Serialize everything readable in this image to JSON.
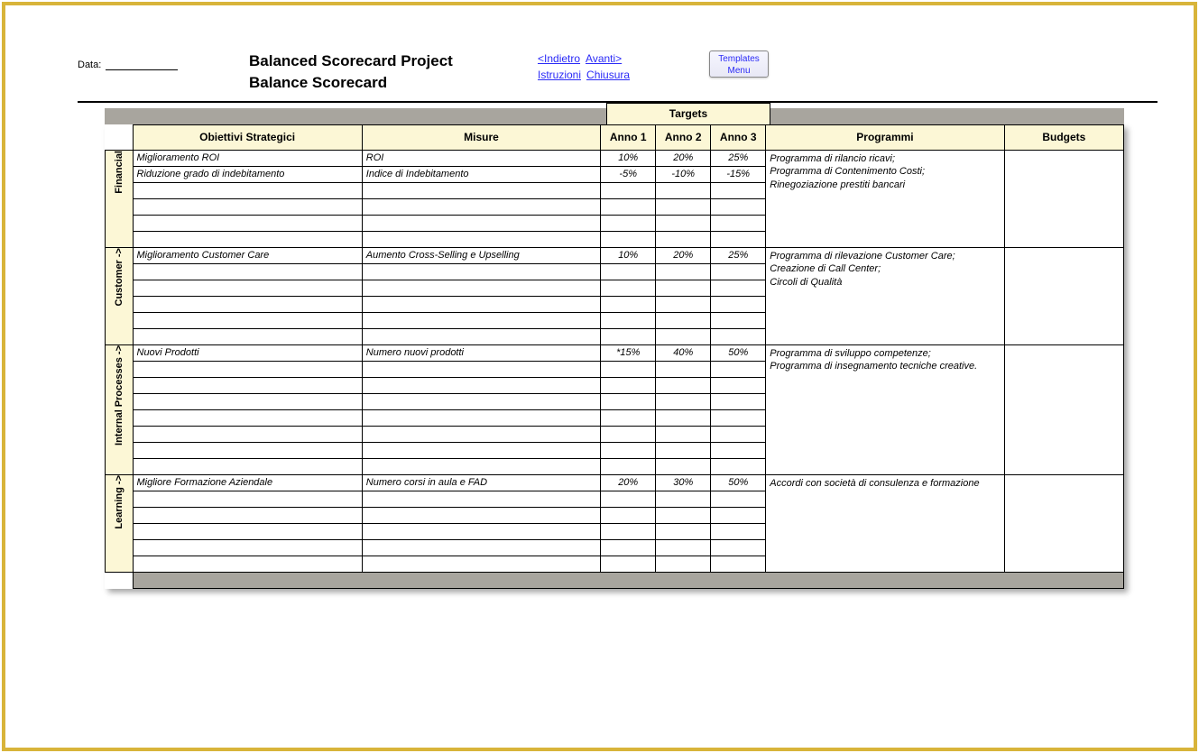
{
  "header": {
    "data_label": "Data:",
    "title_main": "Balanced Scorecard Project",
    "title_sub": "Balance Scorecard",
    "nav": {
      "indietro": "<Indietro",
      "avanti": "Avanti>",
      "istruzioni": "Istruzioni",
      "chiusura": "Chiusura"
    },
    "templates_menu_l1": "Templates",
    "templates_menu_l2": "Menu"
  },
  "table": {
    "targets_header": "Targets",
    "columns": {
      "obiettivi": "Obiettivi Strategici",
      "misure": "Misure",
      "anno1": "Anno 1",
      "anno2": "Anno 2",
      "anno3": "Anno 3",
      "programmi": "Programmi",
      "budgets": "Budgets"
    },
    "perspectives": [
      {
        "name": "Financial",
        "row_count": 6,
        "rows": [
          {
            "obj": "Miglioramento ROI",
            "mis": "ROI",
            "a1": "10%",
            "a2": "20%",
            "a3": "25%"
          },
          {
            "obj": "Riduzione grado di indebitamento",
            "mis": "Indice di Indebitamento",
            "a1": "-5%",
            "a2": "-10%",
            "a3": "-15%"
          }
        ],
        "programmi": "Programma di rilancio ricavi;\nProgramma di Contenimento Costi;\nRinegoziazione prestiti bancari"
      },
      {
        "name": "Customer ->",
        "row_count": 6,
        "rows": [
          {
            "obj": "Miglioramento Customer Care",
            "mis": "Aumento Cross-Selling e Upselling",
            "a1": "10%",
            "a2": "20%",
            "a3": "25%"
          }
        ],
        "programmi": "Programma di rilevazione Customer Care;\nCreazione di Call Center;\nCircoli di Qualità"
      },
      {
        "name": "Internal Processes ->",
        "row_count": 8,
        "rows": [
          {
            "obj": "Nuovi Prodotti",
            "mis": "Numero nuovi prodotti",
            "a1": "*15%",
            "a2": "40%",
            "a3": "50%"
          }
        ],
        "programmi": "Programma di sviluppo competenze;\nProgramma di insegnamento tecniche creative."
      },
      {
        "name": "Learning ->",
        "row_count": 6,
        "rows": [
          {
            "obj": "Migliore Formazione Aziendale",
            "mis": "Numero corsi in aula e FAD",
            "a1": "20%",
            "a2": "30%",
            "a3": "50%"
          }
        ],
        "programmi": "Accordi con società di consulenza e formazione"
      }
    ]
  }
}
